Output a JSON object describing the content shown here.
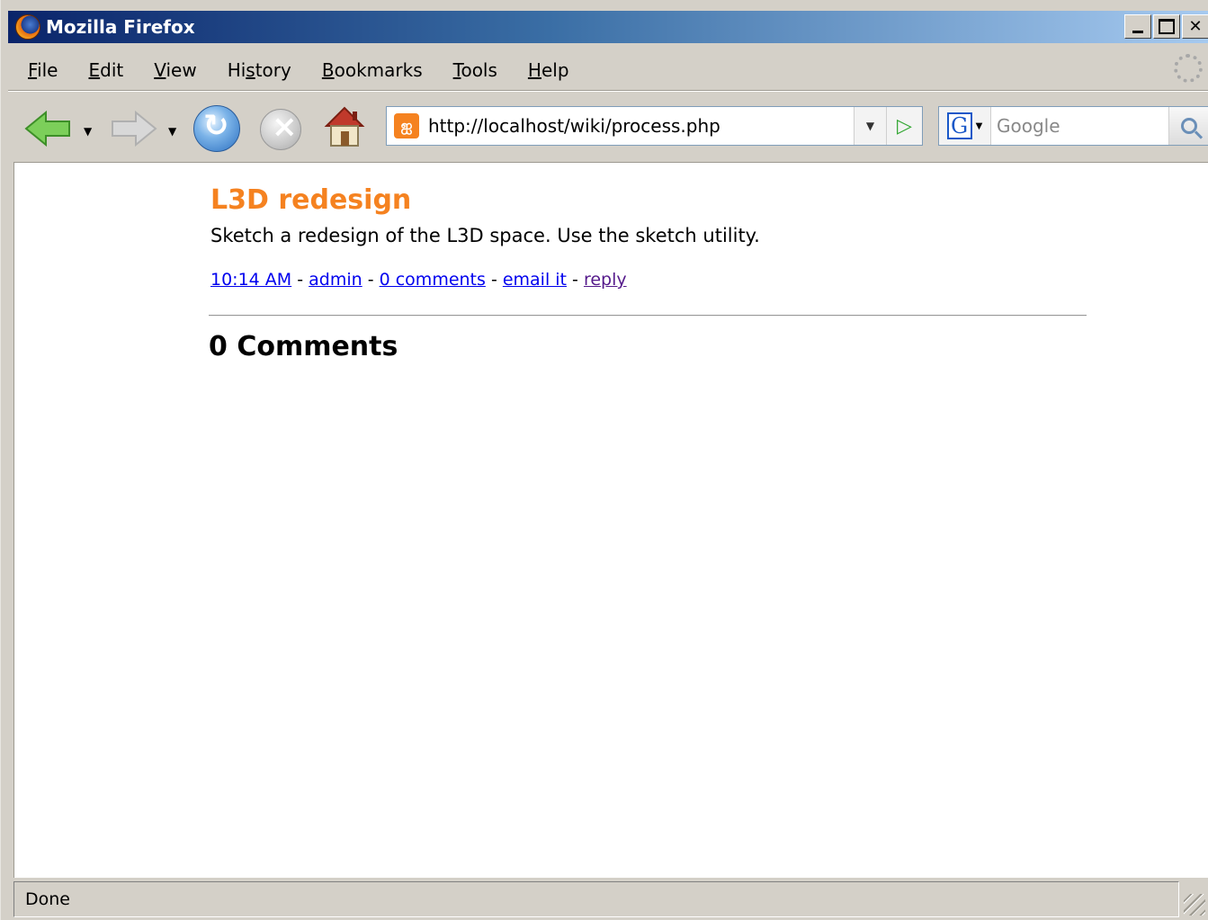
{
  "window": {
    "title": "Mozilla Firefox"
  },
  "menu": {
    "items": [
      {
        "label": "File",
        "accel": "F"
      },
      {
        "label": "Edit",
        "accel": "E"
      },
      {
        "label": "View",
        "accel": "V"
      },
      {
        "label": "History",
        "accel": "s"
      },
      {
        "label": "Bookmarks",
        "accel": "B"
      },
      {
        "label": "Tools",
        "accel": "T"
      },
      {
        "label": "Help",
        "accel": "H"
      }
    ]
  },
  "toolbar": {
    "url": "http://localhost/wiki/process.php",
    "site_icon_glyph": "ஐ",
    "search_placeholder": "Google",
    "search_engine_glyph": "G"
  },
  "post": {
    "title": "L3D redesign",
    "body": "Sketch a redesign of the L3D space. Use the sketch utility.",
    "meta": {
      "time": "10:14 AM",
      "author": "admin",
      "comments_link": "0 comments",
      "email_link": "email it",
      "reply_link": "reply",
      "separator": " - "
    },
    "comments_heading": "0 Comments"
  },
  "status": {
    "text": "Done"
  },
  "colors": {
    "title_accent": "#f58220",
    "link": "#0000ee",
    "visited_link": "#551a8b",
    "titlebar_start": "#0a246a",
    "titlebar_end": "#a6caf0"
  }
}
